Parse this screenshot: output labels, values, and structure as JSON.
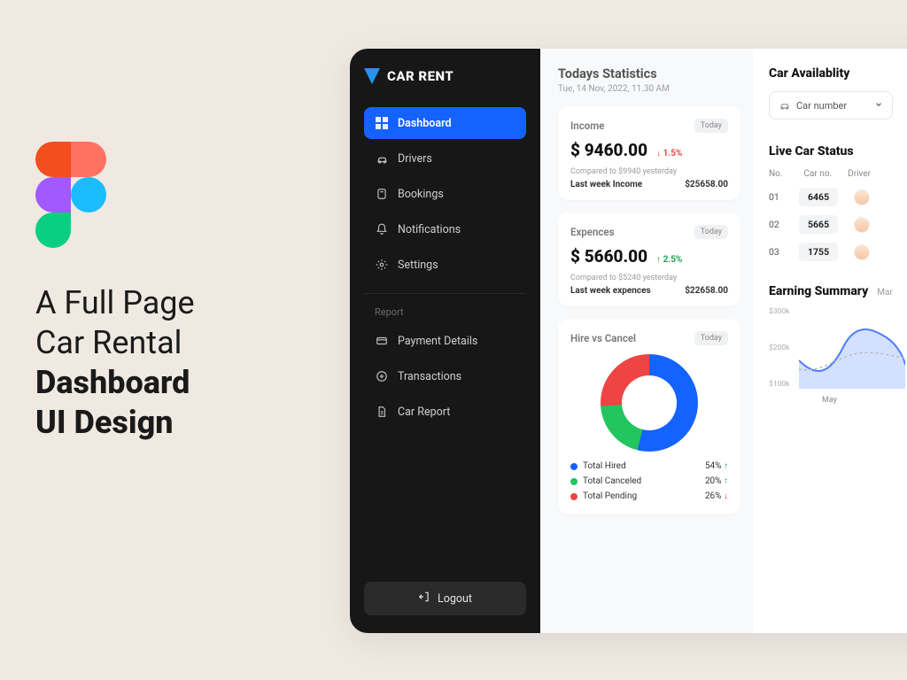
{
  "promo": {
    "line1": "A Full Page",
    "line2": "Car Rental",
    "bold1": "Dashboard",
    "bold2": "UI Design"
  },
  "brand": "CAR RENT",
  "nav": {
    "items": [
      {
        "label": "Dashboard",
        "active": true,
        "icon": "grid-icon"
      },
      {
        "label": "Drivers",
        "active": false,
        "icon": "car-icon"
      },
      {
        "label": "Bookings",
        "active": false,
        "icon": "bookmark-icon"
      },
      {
        "label": "Notifications",
        "active": false,
        "icon": "bell-icon"
      },
      {
        "label": "Settings",
        "active": false,
        "icon": "gear-icon"
      }
    ],
    "report_head": "Report",
    "report_items": [
      {
        "label": "Payment Details",
        "icon": "card-icon"
      },
      {
        "label": "Transactions",
        "icon": "transactions-icon"
      },
      {
        "label": "Car Report",
        "icon": "doc-icon"
      }
    ],
    "logout": "Logout"
  },
  "header": {
    "title": "Todays Statistics",
    "subtitle": "Tue, 14 Nov, 2022, 11.30 AM"
  },
  "income_card": {
    "title": "Income",
    "pill": "Today",
    "value": "$ 9460.00",
    "delta_dir": "down",
    "delta_arrow": "↓",
    "delta": "1.5%",
    "compare": "Compared to $9940 yesterday",
    "lastweek_label": "Last week Income",
    "lastweek_value": "$25658.00"
  },
  "expenses_card": {
    "title": "Expences",
    "pill": "Today",
    "value": "$ 5660.00",
    "delta_dir": "up",
    "delta_arrow": "↑",
    "delta": "2.5%",
    "compare": "Compared to $5240 yesterday",
    "lastweek_label": "Last week expences",
    "lastweek_value": "$22658.00"
  },
  "hire_card": {
    "title": "Hire vs Cancel",
    "pill": "Today",
    "legend": [
      {
        "label": "Total Hired",
        "value": "54%",
        "dir": "up",
        "color": "#1463ff"
      },
      {
        "label": "Total Canceled",
        "value": "20%",
        "dir": "up",
        "color": "#22c55e"
      },
      {
        "label": "Total Pending",
        "value": "26%",
        "dir": "down",
        "color": "#ef4444"
      }
    ]
  },
  "availability": {
    "title": "Car Availablity",
    "dropdown": "Car number"
  },
  "live": {
    "title": "Live Car Status",
    "cols": [
      "No.",
      "Car no.",
      "Driver"
    ],
    "rows": [
      {
        "no": "01",
        "car": "6465"
      },
      {
        "no": "02",
        "car": "5665"
      },
      {
        "no": "03",
        "car": "1755"
      }
    ]
  },
  "earning": {
    "title": "Earning Summary",
    "period": "Mar",
    "ylabels": [
      "$300k",
      "$200k",
      "$100k"
    ],
    "xlabel": "May"
  },
  "chart_data": {
    "type": "pie",
    "title": "Hire vs Cancel",
    "series": [
      {
        "name": "Total Hired",
        "value": 54,
        "color": "#1463ff"
      },
      {
        "name": "Total Canceled",
        "value": 20,
        "color": "#22c55e"
      },
      {
        "name": "Total Pending",
        "value": 26,
        "color": "#ef4444"
      }
    ]
  }
}
